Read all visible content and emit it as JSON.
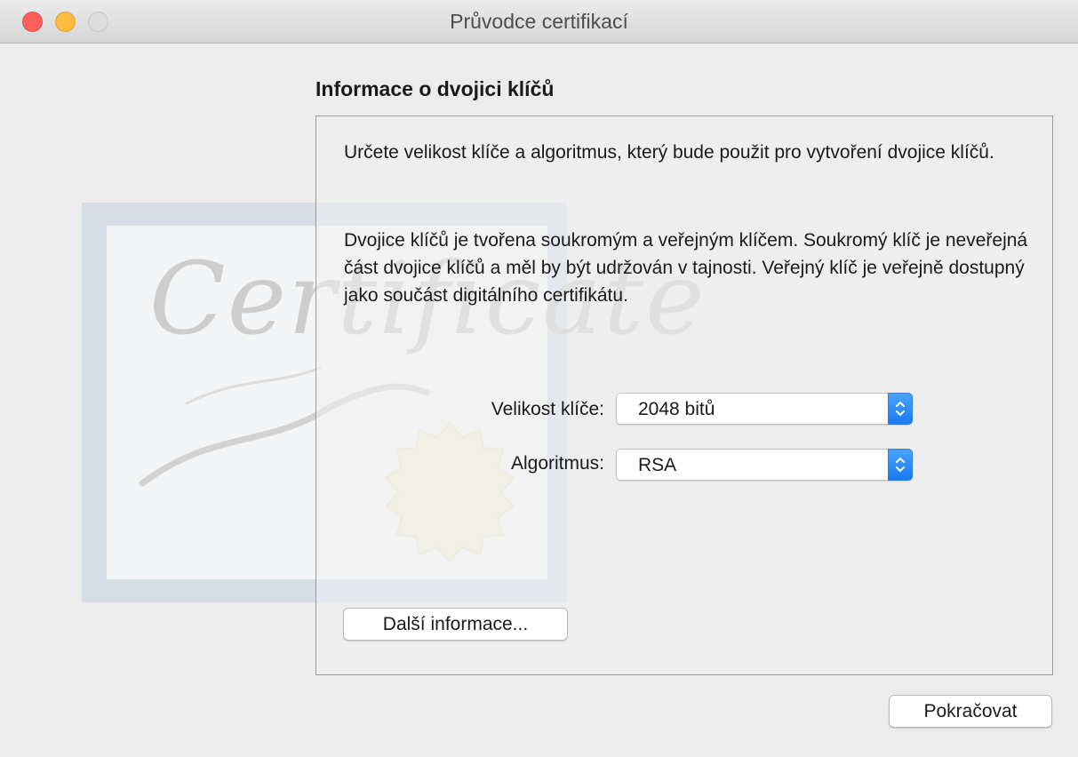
{
  "window": {
    "title": "Průvodce certifikací"
  },
  "artwork": {
    "script_text": "Certificate"
  },
  "content": {
    "heading": "Informace o dvojici klíčů",
    "paragraph1": "Určete velikost klíče a algoritmus, který bude použit pro vytvoření dvojice klíčů.",
    "paragraph2": "Dvojice klíčů je tvořena soukromým a veřejným klíčem. Soukromý klíč je neveřejná část dvojice klíčů a měl by být udržován v tajnosti. Veřejný klíč je veřejně dostupný jako součást digitálního certifikátu."
  },
  "fields": {
    "key_size": {
      "label": "Velikost klíče:",
      "value": "2048 bitů"
    },
    "algorithm": {
      "label": "Algoritmus:",
      "value": "RSA"
    }
  },
  "buttons": {
    "more_info": "Další informace...",
    "continue": "Pokračovat"
  },
  "colors": {
    "close": "#fc605c",
    "minimize": "#fdbc40",
    "accent": "#1a7bf0"
  }
}
